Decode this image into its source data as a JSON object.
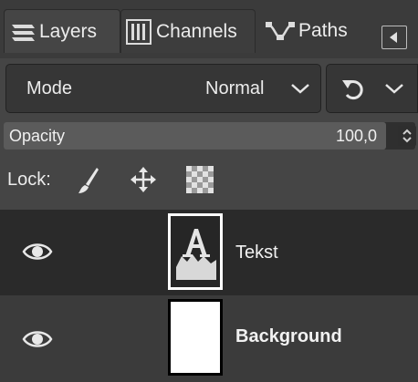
{
  "tabs": [
    {
      "label": "Layers",
      "icon": "layers-icon",
      "active": true
    },
    {
      "label": "Channels",
      "icon": "channels-icon",
      "active": false
    },
    {
      "label": "Paths",
      "icon": "paths-icon",
      "active": false
    }
  ],
  "mode": {
    "label": "Mode",
    "value": "Normal"
  },
  "opacity": {
    "label": "Opacity",
    "value": "100,0",
    "fraction": 0.93
  },
  "lock": {
    "label": "Lock:",
    "icons": [
      "lock-pixels-icon",
      "lock-position-icon",
      "lock-alpha-icon"
    ]
  },
  "layers": [
    {
      "name": "Tekst",
      "visible": true,
      "selected": true,
      "type": "text"
    },
    {
      "name": "Background",
      "visible": true,
      "selected": false,
      "type": "image"
    }
  ],
  "colors": {
    "panel": "#454545",
    "selected_row": "#2a2a2a",
    "text": "#ececec"
  }
}
